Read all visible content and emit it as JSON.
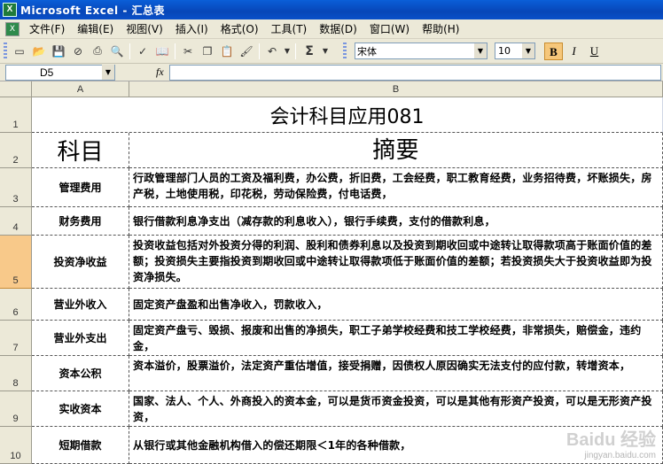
{
  "window": {
    "title": "Microsoft Excel - 汇总表",
    "app_icon": "excel-icon"
  },
  "menu": {
    "items": [
      "文件(F)",
      "编辑(E)",
      "视图(V)",
      "插入(I)",
      "格式(O)",
      "工具(T)",
      "数据(D)",
      "窗口(W)",
      "帮助(H)"
    ]
  },
  "toolbar": {
    "font_name": "宋体",
    "font_size": "10",
    "bold_label": "B",
    "italic_label": "I",
    "underline_label": "U",
    "sum_label": "Σ"
  },
  "formula_bar": {
    "name_box": "D5",
    "fx_label": "fx",
    "formula": ""
  },
  "grid": {
    "columns": [
      "A",
      "B"
    ],
    "selected_row": "5",
    "rows": [
      {
        "num": "1",
        "title": "会计科目应用081"
      },
      {
        "num": "2",
        "a": "科目",
        "b": "摘要"
      },
      {
        "num": "3",
        "a": "管理费用",
        "b": "行政管理部门人员的工资及福利费，办公费，折旧费，工会经费，职工教育经费，业务招待费，坏账损失，房产税，土地使用税，印花税，劳动保险费，付电话费，"
      },
      {
        "num": "4",
        "a": "财务费用",
        "b": "银行借款利息净支出（减存款的利息收入），银行手续费，支付的借款利息，"
      },
      {
        "num": "5",
        "a": "投资净收益",
        "b": "投资收益包括对外投资分得的利润、股利和债券利息以及投资到期收回或中途转让取得款项高于账面价值的差额；投资损失主要指投资到期收回或中途转让取得款项低于账面价值的差额；若投资损失大于投资收益即为投资净损失。"
      },
      {
        "num": "6",
        "a": "营业外收入",
        "b": "固定资产盘盈和出售净收入，罚款收入，"
      },
      {
        "num": "7",
        "a": "营业外支出",
        "b": "固定资产盘亏、毁损、报废和出售的净损失，职工子弟学校经费和技工学校经费，非常损失，赔偿金，违约金，"
      },
      {
        "num": "8",
        "a": "资本公积",
        "b": "资本溢价，股票溢价，法定资产重估增值，接受捐赠，因债权人原因确实无法支付的应付款，转增资本，"
      },
      {
        "num": "9",
        "a": "实收资本",
        "b": "国家、法人、个人、外商投入的资本金，可以是货币资金投资，可以是其他有形资产投资，可以是无形资产投资，"
      },
      {
        "num": "10",
        "a": "短期借款",
        "b": "从银行或其他金融机构借入的偿还期限＜1年的各种借款，"
      }
    ]
  },
  "watermark": {
    "brand": "Baidu 经验",
    "url": "jingyan.baidu.com"
  }
}
